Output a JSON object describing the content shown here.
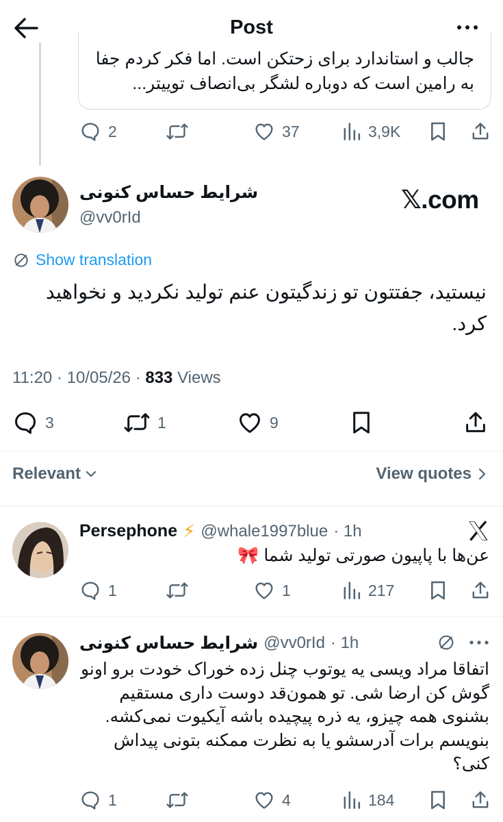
{
  "header": {
    "title": "Post"
  },
  "quoted": {
    "text": "جالب و استاندارد برای زحتکن است. اما فکر کردم جفا به رامین است که دوباره لشگر بی‌انصاف توییتر...",
    "stats": {
      "replies": "2",
      "reposts": "",
      "likes": "37",
      "views": "3,9K"
    }
  },
  "post": {
    "author_name": "شرایط حساس کنونی",
    "author_handle": "@vv0rId",
    "watermark": "𝕏.com",
    "translate_label": "Show translation",
    "text": "نیستید، جفتتون تو زندگیتون عنم تولید نکردید و نخواهید کرد.",
    "time": "11:20 · 10/05/26 · ",
    "views_count": "833",
    "views_label": " Views",
    "stats": {
      "replies": "3",
      "reposts": "1",
      "likes": "9"
    }
  },
  "filter": {
    "sort_label": "Relevant",
    "quotes_label": "View quotes"
  },
  "replies": [
    {
      "name": "Persephone",
      "badge": "⚡",
      "handle": "@whale1997blue",
      "time": "· 1h",
      "text": "عن‌ها با پاپیون صورتی تولید شما 🎀",
      "stats": {
        "replies": "1",
        "reposts": "",
        "likes": "1",
        "views": "217"
      }
    },
    {
      "name": "شرایط حساس کنونی",
      "handle": "@vv0rId",
      "time": "· 1h",
      "text": "اتفاقا مراد ویسی یه یوتوب چنل زده خوراک خودت برو اونو گوش کن ارضا شی. تو همون‌قد دوست داری مستقیم بشنوی همه چیزو، یه ذره پیچیده باشه آیکیوت نمی‌کشه. بنویسم برات آدرسشو یا به نظرت ممکنه بتونی پیداش کنی؟",
      "stats": {
        "replies": "1",
        "reposts": "",
        "likes": "4",
        "views": "184"
      }
    }
  ],
  "colors": {
    "accent": "#1d9bf0",
    "muted": "#536471",
    "text": "#0f1419",
    "border": "#cfd9de"
  }
}
